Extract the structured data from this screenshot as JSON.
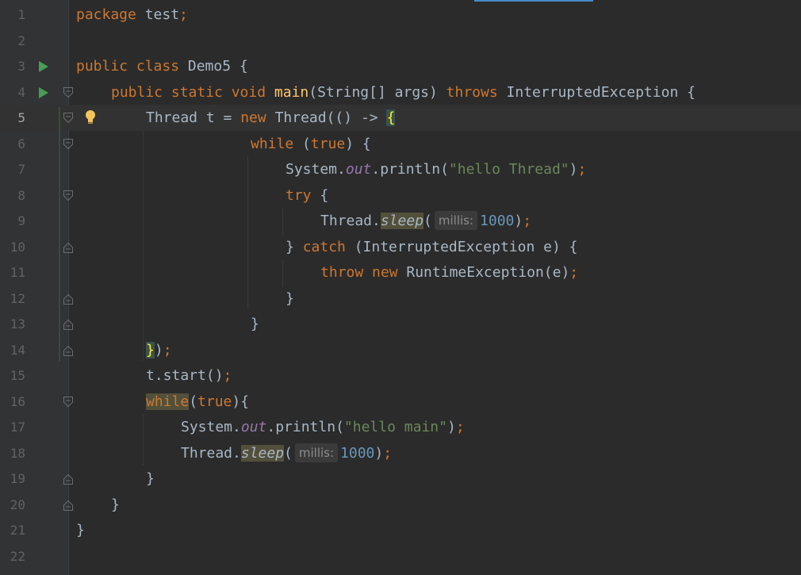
{
  "editor": {
    "current_line": 5,
    "lines": [
      {
        "n": "1"
      },
      {
        "n": "2"
      },
      {
        "n": "3"
      },
      {
        "n": "4"
      },
      {
        "n": "5"
      },
      {
        "n": "6"
      },
      {
        "n": "7"
      },
      {
        "n": "8"
      },
      {
        "n": "9"
      },
      {
        "n": "10"
      },
      {
        "n": "11"
      },
      {
        "n": "12"
      },
      {
        "n": "13"
      },
      {
        "n": "14"
      },
      {
        "n": "15"
      },
      {
        "n": "16"
      },
      {
        "n": "17"
      },
      {
        "n": "18"
      },
      {
        "n": "19"
      },
      {
        "n": "20"
      },
      {
        "n": "21"
      },
      {
        "n": "22"
      }
    ],
    "tokens": {
      "l1_kw": "package",
      "l1_id": " test",
      "l1_semi": ";",
      "l3_kw": "public class",
      "l3_id": " Demo5 {",
      "l4_kw1": "public static void",
      "l4_fn": "main",
      "l4_args": "(String[] args) ",
      "l4_kw2": "throws",
      "l4_exc": " InterruptedException {",
      "l5_a": "Thread t = ",
      "l5_kw": "new",
      "l5_b": " Thread(() -> ",
      "l5_brace": "{",
      "l6_kw": "while",
      "l6_a": " (",
      "l6_kw2": "true",
      "l6_b": ") {",
      "l7_a": "System.",
      "l7_field": "out",
      "l7_b": ".println(",
      "l7_str": "\"hello Thread\"",
      "l7_c": ")",
      "l7_semi": ";",
      "l8_kw": "try",
      "l8_a": " {",
      "l9_a": "Thread.",
      "l9_call": "sleep",
      "l9_b": "(",
      "l9_hint": "millis:",
      "l9_num": "1000",
      "l9_c": ")",
      "l9_semi": ";",
      "l10_a": "} ",
      "l10_kw": "catch",
      "l10_b": " (InterruptedException e) {",
      "l11_kw1": "throw",
      "l11_kw2": " new",
      "l11_a": " RuntimeException(e)",
      "l11_semi": ";",
      "l12_a": "}",
      "l13_a": "}",
      "l14_brace": "}",
      "l14_a": ")",
      "l14_semi": ";",
      "l15_a": "t.start()",
      "l15_semi": ";",
      "l16_kw": "while",
      "l16_a": "(",
      "l16_kw2": "true",
      "l16_b": "){",
      "l17_a": "System.",
      "l17_field": "out",
      "l17_b": ".println(",
      "l17_str": "\"hello main\"",
      "l17_c": ")",
      "l17_semi": ";",
      "l18_a": "Thread.",
      "l18_call": "sleep",
      "l18_b": "(",
      "l18_hint": "millis:",
      "l18_num": "1000",
      "l18_c": ")",
      "l18_semi": ";",
      "l19_a": "}",
      "l20_a": "}",
      "l21_a": "}"
    }
  },
  "colors": {
    "background": "#2b2b2b",
    "keyword": "#cc7832",
    "function": "#ffc66d",
    "string": "#6a8759",
    "number": "#6897bb",
    "field": "#9876aa",
    "run_icon": "#499c54"
  },
  "icons": {
    "run": "run-icon",
    "fold": "fold-icon",
    "intention": "lightbulb-icon"
  }
}
